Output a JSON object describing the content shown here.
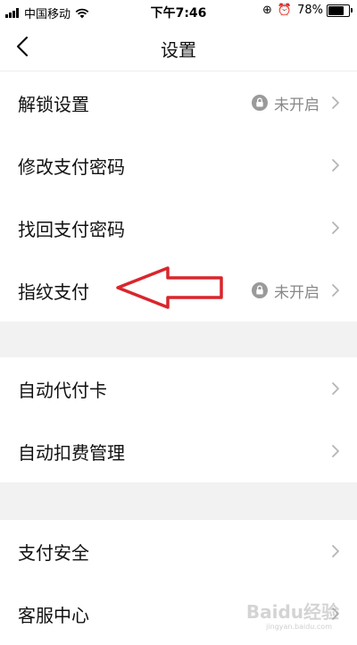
{
  "status_bar": {
    "carrier": "中国移动",
    "time": "下午7:46",
    "battery_percent": "78%",
    "battery_level": 0.78
  },
  "nav": {
    "title": "设置"
  },
  "sections": [
    {
      "rows": [
        {
          "label": "解锁设置",
          "status": "未开启"
        },
        {
          "label": "修改支付密码"
        },
        {
          "label": "找回支付密码"
        },
        {
          "label": "指纹支付",
          "status": "未开启"
        }
      ]
    },
    {
      "rows": [
        {
          "label": "自动代付卡"
        },
        {
          "label": "自动扣费管理"
        }
      ]
    },
    {
      "rows": [
        {
          "label": "支付安全"
        },
        {
          "label": "客服中心"
        }
      ]
    }
  ],
  "colors": {
    "annotation_arrow": "#d9262c",
    "section_gap": "#f2f2f2",
    "secondary_text": "#888888"
  },
  "watermark": {
    "text": "Baidu经验",
    "url_text": "jingyan.baidu.com"
  }
}
